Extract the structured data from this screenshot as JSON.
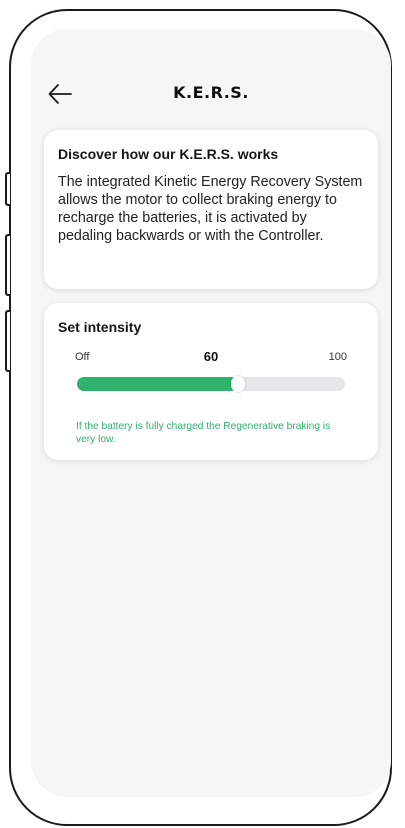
{
  "header": {
    "title": "K.E.R.S.",
    "back_icon": "arrow-left-icon"
  },
  "info_card": {
    "title": "Discover how our K.E.R.S. works",
    "body": "The integrated Kinetic Energy Recovery System allows the motor to collect braking energy to recharge the batteries, it is activated by pedaling backwards or with the Controller."
  },
  "intensity_card": {
    "title": "Set intensity",
    "min_label": "Off",
    "value_label": "60",
    "max_label": "100",
    "value": 60,
    "max": 100,
    "note": "If the battery is fully charged the Regenerative braking is very low."
  },
  "colors": {
    "accent": "#2fb36c",
    "track": "#e6e7ea",
    "background": "#f6f6f6"
  }
}
